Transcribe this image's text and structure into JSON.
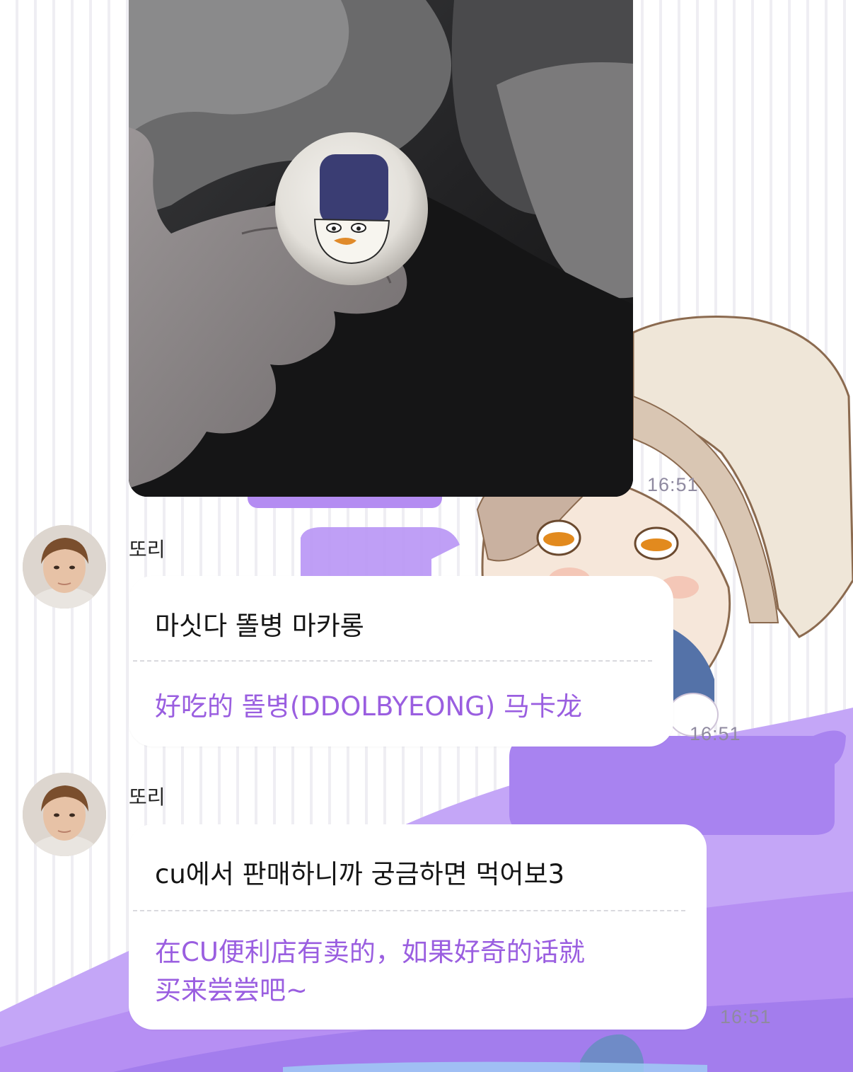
{
  "messages": [
    {
      "type": "photo",
      "image_description": "hand holding macaron",
      "time": "16:51"
    },
    {
      "type": "text",
      "sender": "또리",
      "original": "마싯다 똘병 마카롱",
      "translation": "好吃的 똘병(DDOLBYEONG) 马卡龙",
      "time": "16:51"
    },
    {
      "type": "text",
      "sender": "또리",
      "original": "cu에서 판매하니까 궁금하면 먹어보3",
      "translation_line1": "在CU便利店有卖的，如果好奇的话就",
      "translation_line2": "买来尝尝吧~",
      "time": "16:51"
    }
  ],
  "colors": {
    "accent_purple": "#9a5ee0",
    "wallpaper_purple": "#b48cf2",
    "bubble": "#ffffff",
    "time_text": "#8f8aa0"
  }
}
